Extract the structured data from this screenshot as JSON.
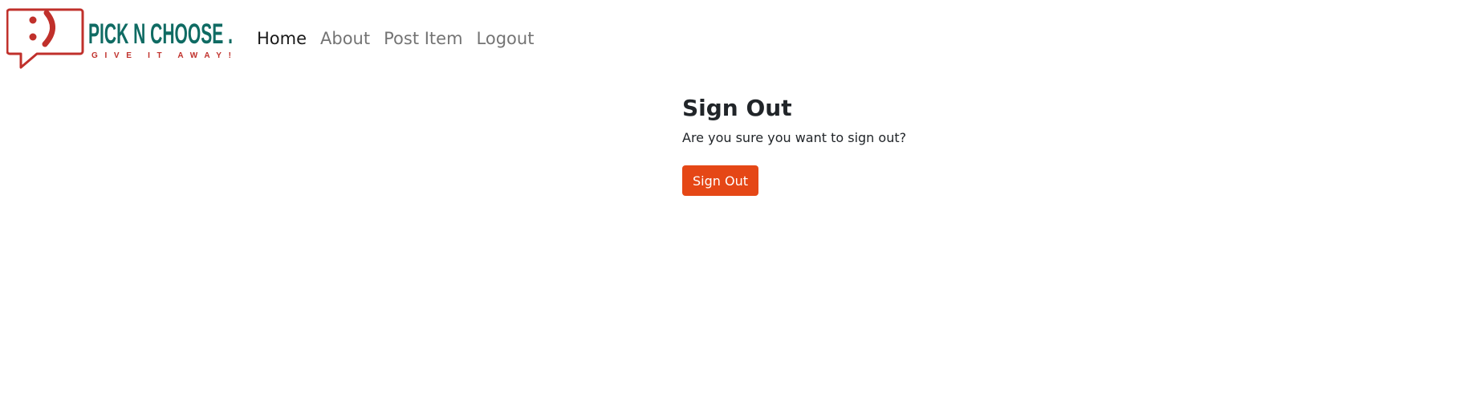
{
  "brand": {
    "name": "PICK N CHOOSE .",
    "tagline": "GIVE IT AWAY!",
    "icon": "smiley-speech-bubble-icon",
    "colors": {
      "teal": "#0f6b63",
      "red": "#c0302b"
    }
  },
  "nav": {
    "items": [
      {
        "label": "Home",
        "active": true
      },
      {
        "label": "About",
        "active": false
      },
      {
        "label": "Post Item",
        "active": false
      },
      {
        "label": "Logout",
        "active": false
      }
    ]
  },
  "main": {
    "title": "Sign Out",
    "message": "Are you sure you want to sign out?",
    "button_label": "Sign Out",
    "button_color": "#e54716"
  }
}
